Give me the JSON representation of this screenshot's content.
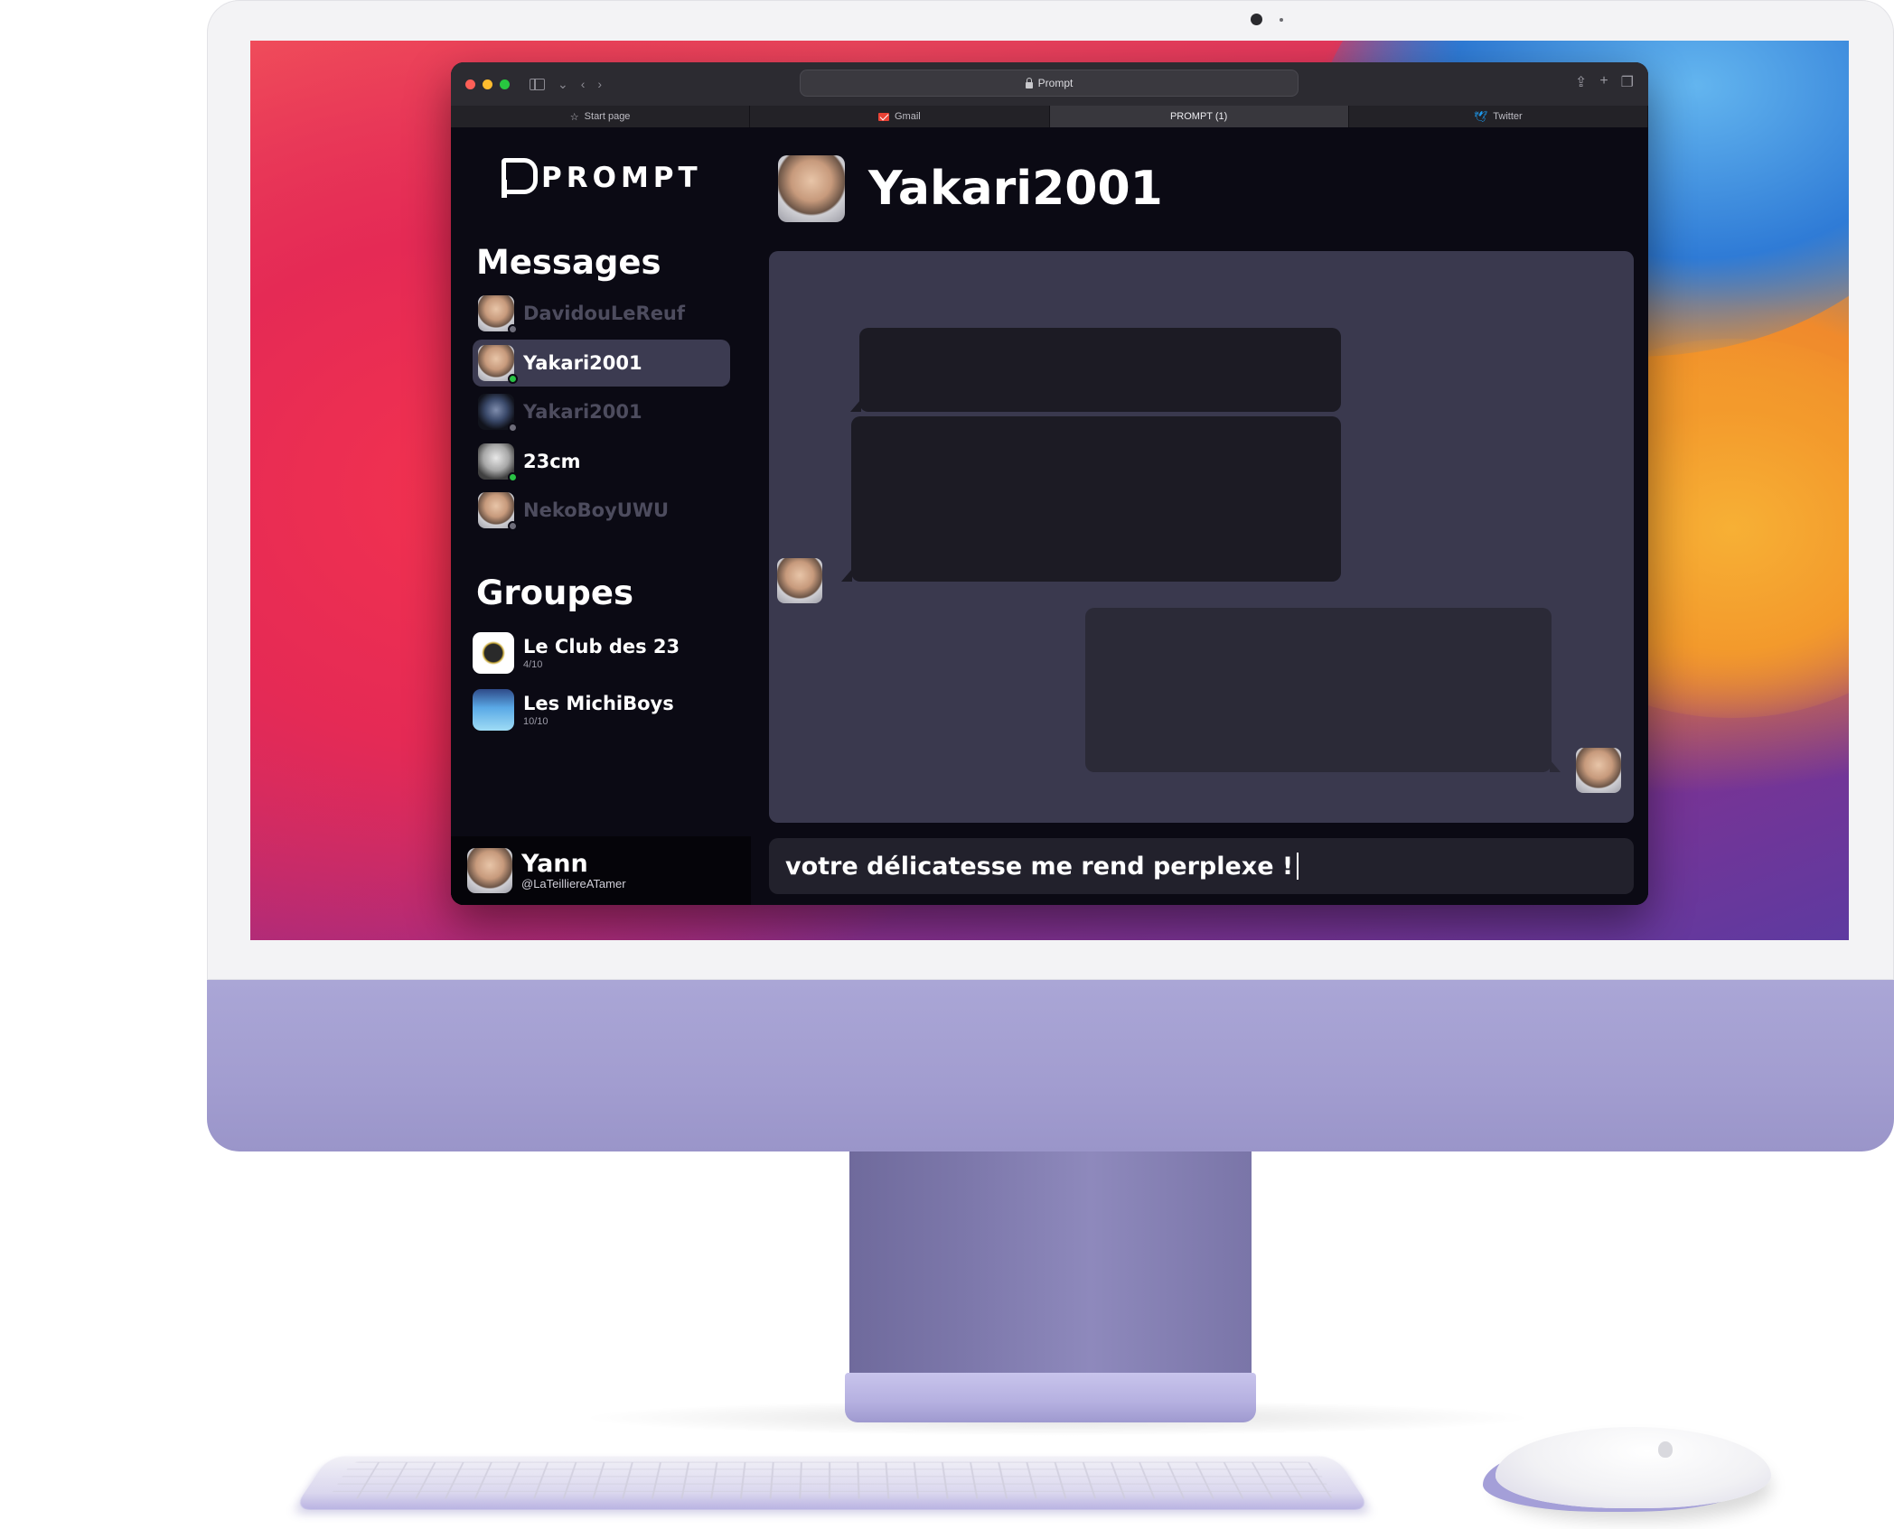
{
  "browser": {
    "url": "Prompt",
    "tabs": [
      {
        "label": "Start page",
        "icon": "star-icon"
      },
      {
        "label": "Gmail",
        "icon": "gmail-icon"
      },
      {
        "label": "PROMPT (1)",
        "icon": ""
      },
      {
        "label": "Twitter",
        "icon": "twitter-icon"
      }
    ]
  },
  "app": {
    "logo": "PROMPT",
    "messages_title": "Messages",
    "contacts": [
      {
        "name": "DavidouLeReuf",
        "status": "offline"
      },
      {
        "name": "Yakari2001",
        "status": "online",
        "active": true
      },
      {
        "name": "Yakari2001",
        "status": "offline"
      },
      {
        "name": "23cm",
        "status": "online"
      },
      {
        "name": "NekoBoyUWU",
        "status": "offline"
      }
    ],
    "groups_title": "Groupes",
    "groups": [
      {
        "name": "Le Club des 23",
        "count": "4/10"
      },
      {
        "name": "Les MichiBoys",
        "count": "10/10"
      }
    ],
    "me": {
      "name": "Yann",
      "handle": "@LaTeilliereATamer"
    }
  },
  "chat": {
    "title": "Yakari2001",
    "composer_text": "votre délicatesse me rend perplexe !"
  },
  "colors": {
    "app_background": "#0b0a14",
    "conversation_background": "#3a394e",
    "active_contact": "#3c3b51",
    "online": "#29c244",
    "imac_purple": "#a29dd0"
  }
}
